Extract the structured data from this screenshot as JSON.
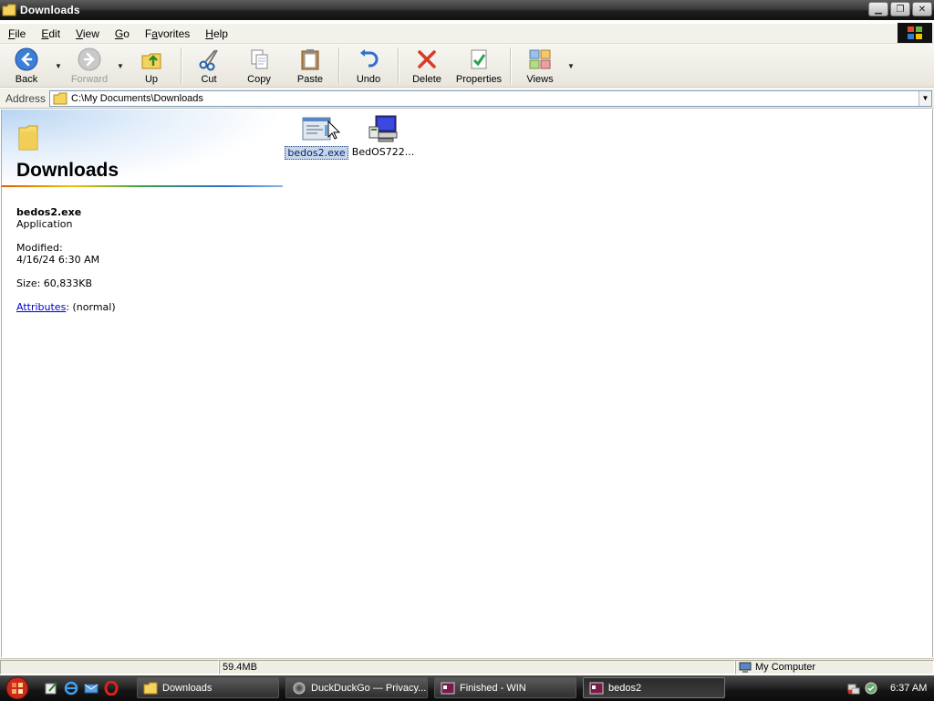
{
  "window": {
    "title": "Downloads"
  },
  "menu": [
    {
      "pre": "",
      "acc": "F",
      "post": "ile"
    },
    {
      "pre": "",
      "acc": "E",
      "post": "dit"
    },
    {
      "pre": "",
      "acc": "V",
      "post": "iew"
    },
    {
      "pre": "",
      "acc": "G",
      "post": "o"
    },
    {
      "pre": "F",
      "acc": "a",
      "post": "vorites"
    },
    {
      "pre": "",
      "acc": "H",
      "post": "elp"
    }
  ],
  "toolbar": {
    "back": "Back",
    "forward": "Forward",
    "up": "Up",
    "cut": "Cut",
    "copy": "Copy",
    "paste": "Paste",
    "undo": "Undo",
    "delete": "Delete",
    "properties": "Properties",
    "views": "Views"
  },
  "address": {
    "label": "Address",
    "value": "C:\\My Documents\\Downloads"
  },
  "webview": {
    "title": "Downloads",
    "file_name": "bedos2.exe",
    "file_type": "Application",
    "modified_label": "Modified:",
    "modified_value": "4/16/24 6:30 AM",
    "size": "Size: 60,833KB",
    "attributes_link": "Attributes",
    "attributes_value": ": (normal)"
  },
  "files": [
    {
      "name": "bedos2.exe",
      "icon": "application-window-icon",
      "selected": true
    },
    {
      "name": "BedOS722...",
      "icon": "installer-computer-icon",
      "selected": false
    }
  ],
  "status": {
    "left": "",
    "size": "59.4MB",
    "zone": "My Computer"
  },
  "taskbar": {
    "tasks": [
      {
        "label": "Downloads",
        "icon": "folder-icon"
      },
      {
        "label": "DuckDuckGo — Privacy...",
        "icon": "browser-icon"
      },
      {
        "label": "Finished - WIN",
        "icon": "app-icon"
      },
      {
        "label": "bedos2",
        "icon": "app-icon"
      }
    ],
    "clock": "6:37 AM"
  }
}
